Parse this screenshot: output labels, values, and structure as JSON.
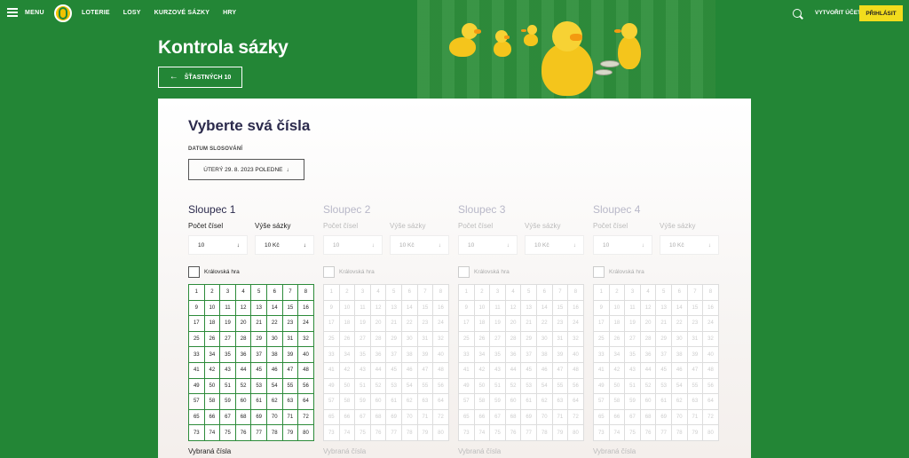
{
  "header": {
    "menu_label": "MENU",
    "nav": [
      "LOTERIE",
      "LOSY",
      "KURZOVÉ SÁZKY",
      "HRY"
    ],
    "create_account": "VYTVOŘIT ÚČET",
    "login": "PŘIHLÁSIT"
  },
  "page": {
    "title": "Kontrola sázky",
    "back_button": "ŠŤASTNÝCH 10",
    "back_arrow": "←"
  },
  "form": {
    "title": "Vyberte svá čísla",
    "date_label": "DATUM SLOSOVÁNÍ",
    "date_value": "ÚTERÝ 29. 8. 2023 POLEDNE",
    "date_arrow": "↓"
  },
  "columns": [
    {
      "title": "Sloupec 1",
      "count_label": "Počet čísel",
      "stake_label": "Výše sázky",
      "count_value": "10",
      "stake_value": "10 Kč",
      "king_label": "Královská hra",
      "selected_label": "Vybraná čísla",
      "enabled": true
    },
    {
      "title": "Sloupec 2",
      "count_label": "Počet čísel",
      "stake_label": "Výše sázky",
      "count_value": "10",
      "stake_value": "10 Kč",
      "king_label": "Královská hra",
      "selected_label": "Vybraná čísla",
      "enabled": false
    },
    {
      "title": "Sloupec 3",
      "count_label": "Počet čísel",
      "stake_label": "Výše sázky",
      "count_value": "10",
      "stake_value": "10 Kč",
      "king_label": "Královská hra",
      "selected_label": "Vybraná čísla",
      "enabled": false
    },
    {
      "title": "Sloupec 4",
      "count_label": "Počet čísel",
      "stake_label": "Výše sázky",
      "count_value": "10",
      "stake_value": "10 Kč",
      "king_label": "Královská hra",
      "selected_label": "Vybraná čísla",
      "enabled": false
    }
  ],
  "numbers": [
    1,
    2,
    3,
    4,
    5,
    6,
    7,
    8,
    9,
    10,
    11,
    12,
    13,
    14,
    15,
    16,
    17,
    18,
    19,
    20,
    21,
    22,
    23,
    24,
    25,
    26,
    27,
    28,
    29,
    30,
    31,
    32,
    33,
    34,
    35,
    36,
    37,
    38,
    39,
    40,
    41,
    42,
    43,
    44,
    45,
    46,
    47,
    48,
    49,
    50,
    51,
    52,
    53,
    54,
    55,
    56,
    57,
    58,
    59,
    60,
    61,
    62,
    63,
    64,
    65,
    66,
    67,
    68,
    69,
    70,
    71,
    72,
    73,
    74,
    75,
    76,
    77,
    78,
    79,
    80
  ],
  "colors": {
    "brand_green": "#238636",
    "accent_yellow": "#f2dc1d",
    "grid_green": "#2d8b3a"
  }
}
